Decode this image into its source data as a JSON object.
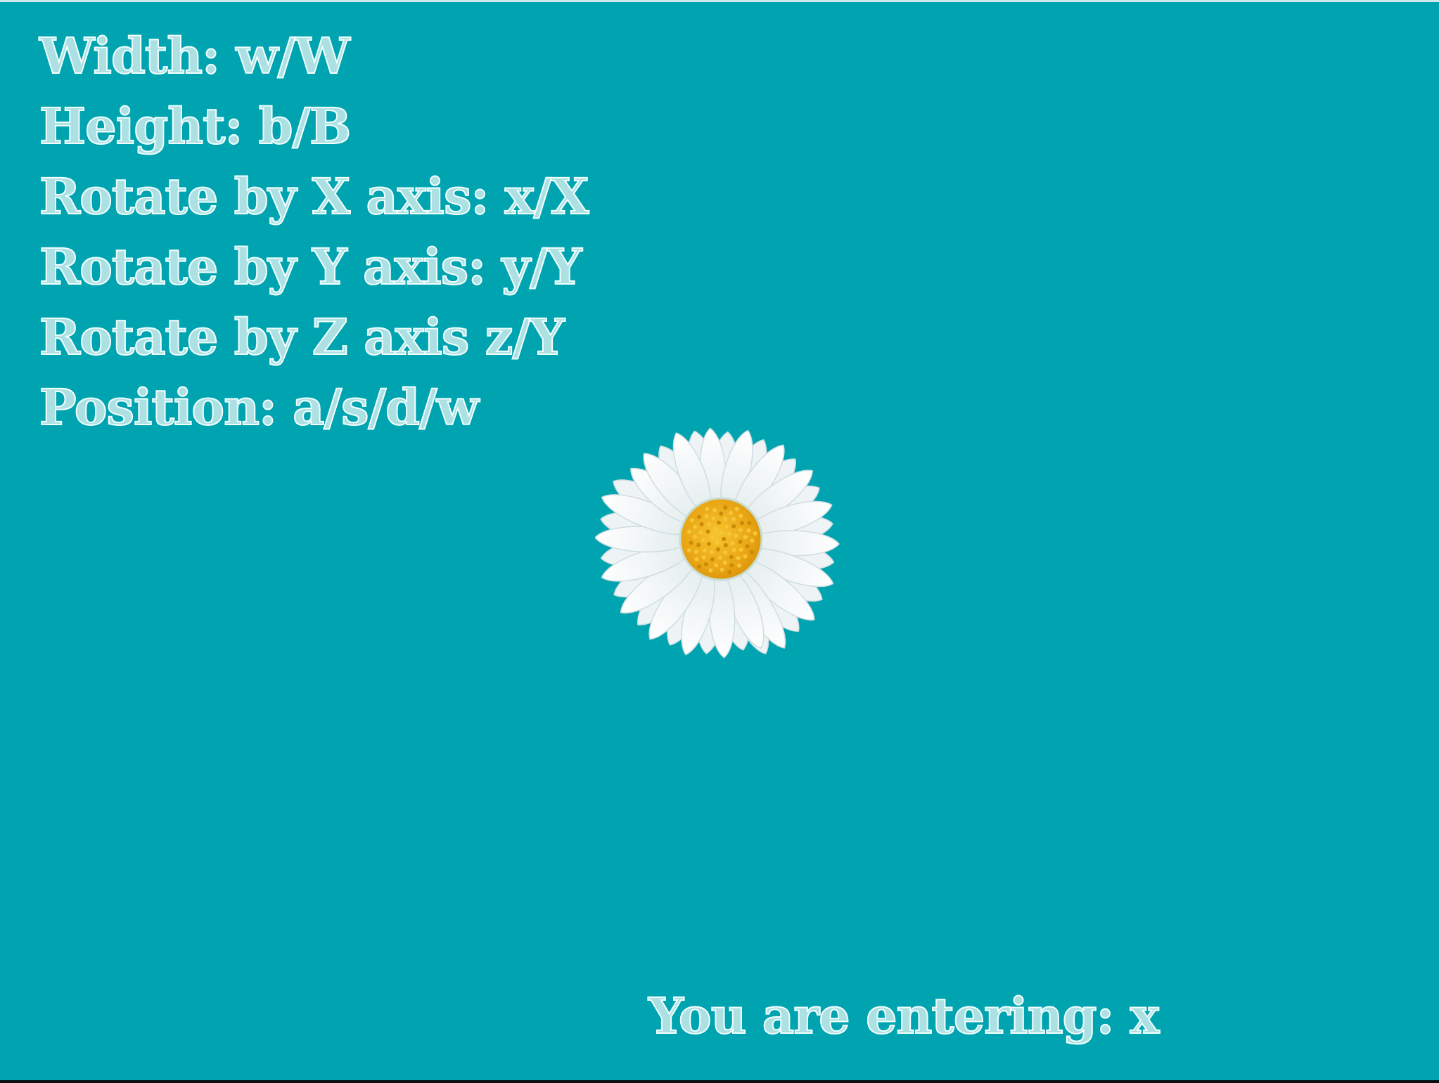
{
  "help": {
    "lines": [
      "Width: w/W",
      "Height: b/B",
      "Rotate by X axis: x/X",
      "Rotate by Y axis: y/Y",
      "Rotate by Z axis z/Y",
      "Position: a/s/d/w"
    ]
  },
  "status": {
    "text": "You are entering: x"
  },
  "colors": {
    "background": "#00a4b0",
    "text": "#f2ffff",
    "petal": "#ffffff",
    "center": "#f2b21a"
  },
  "icons": {
    "flower": "daisy-icon"
  }
}
